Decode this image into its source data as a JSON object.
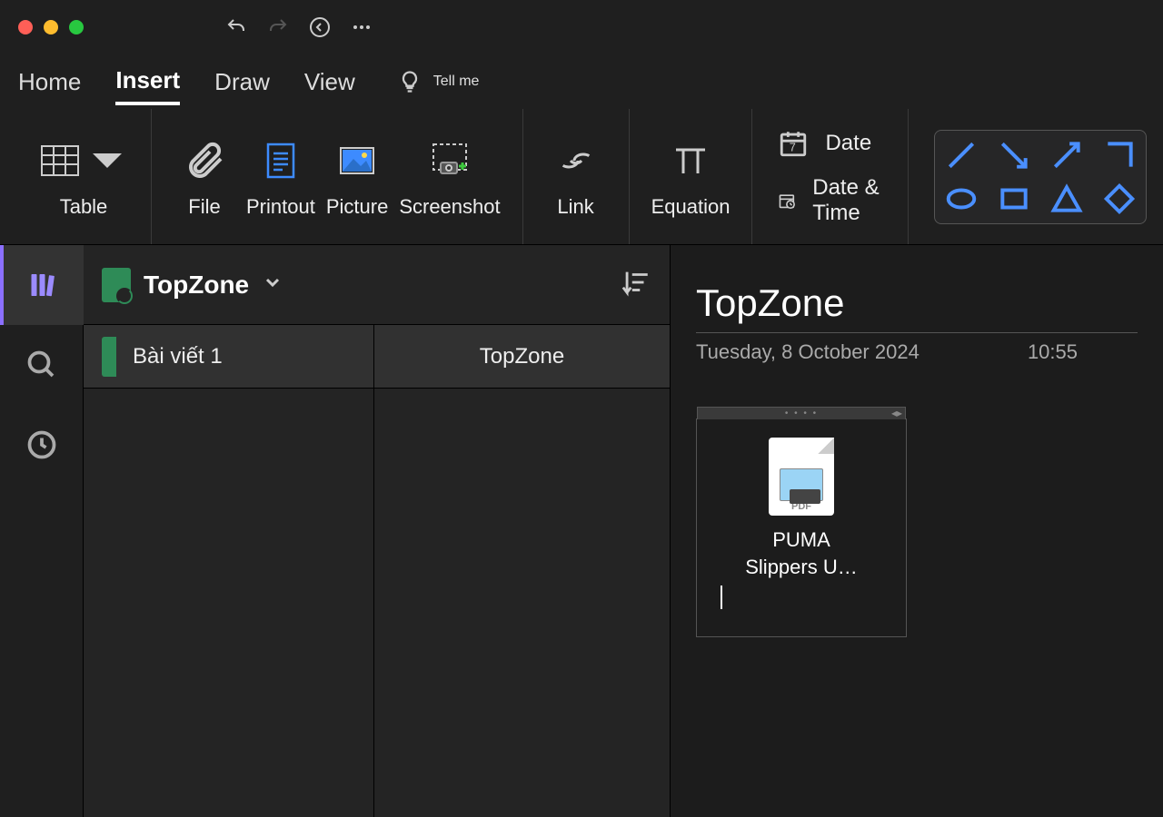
{
  "tabs": {
    "home": "Home",
    "insert": "Insert",
    "draw": "Draw",
    "view": "View",
    "tellme": "Tell me"
  },
  "ribbon": {
    "table": "Table",
    "file": "File",
    "printout": "Printout",
    "picture": "Picture",
    "screenshot": "Screenshot",
    "link": "Link",
    "equation": "Equation",
    "date": "Date",
    "datetime": "Date & Time"
  },
  "notebook": {
    "name": "TopZone"
  },
  "sections": [
    {
      "name": "Bài viết 1"
    }
  ],
  "pages": [
    {
      "name": "TopZone"
    }
  ],
  "page": {
    "title": "TopZone",
    "date": "Tuesday, 8 October 2024",
    "time": "10:55"
  },
  "attachment": {
    "type": "PDF",
    "name_line1": "PUMA",
    "name_line2": "Slippers U…"
  }
}
